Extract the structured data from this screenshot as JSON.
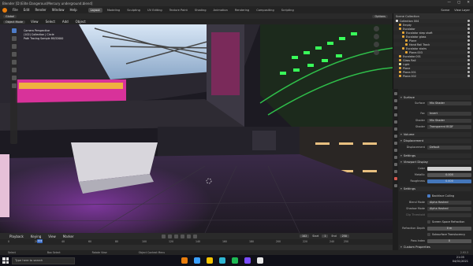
{
  "window": {
    "title": "Blender [D:\\Elite Dangerous\\Mercury underground.blend]",
    "controls": [
      "—",
      "▢",
      "✕"
    ]
  },
  "menubar": {
    "menus": [
      "File",
      "Edit",
      "Render",
      "Window",
      "Help"
    ],
    "workspaces": [
      "Layout",
      "Modeling",
      "Sculpting",
      "UV Editing",
      "Texture Paint",
      "Shading",
      "Animation",
      "Rendering",
      "Compositing",
      "Scripting"
    ],
    "active_workspace": "Layout",
    "scene": "Scene",
    "view_layer": "View Layer"
  },
  "toolbar": {
    "transform": "Global",
    "options": "Options"
  },
  "viewport_header": {
    "mode": "Object Mode",
    "menus": [
      "View",
      "Select",
      "Add",
      "Object"
    ]
  },
  "viewport": {
    "overlay_text": [
      "Camera Perspective",
      "(102) Collection | Circle",
      "Path Tracing Sample 89/32000"
    ]
  },
  "timeline": {
    "menus": [
      "Playback",
      "Keying",
      "View",
      "Marker"
    ],
    "current_frame": "102",
    "start_label": "Start",
    "start_value": "1",
    "end_label": "End",
    "end_value": "250",
    "ticks": [
      "0",
      "20",
      "40",
      "60",
      "80",
      "100",
      "120",
      "140",
      "160",
      "180",
      "200",
      "220",
      "240",
      "250"
    ]
  },
  "statusbar": {
    "items": [
      "Select",
      "Box Select",
      "Rotate View",
      "Object Context Menu"
    ],
    "version": "2.93.3"
  },
  "taskbar": {
    "search_placeholder": "Type here to search",
    "time": "21:05",
    "date": "04/01/2021",
    "icon_colors": [
      "#e87d0d",
      "#3aa0ff",
      "#f5c400",
      "#2fb7d4",
      "#1db954",
      "#7a4cff",
      "#e8e8e8"
    ]
  },
  "outliner": {
    "header": "Scene Collection",
    "rows": [
      {
        "label": "Collection 004",
        "indent": 0,
        "color": "#e0e0e0"
      },
      {
        "label": "Empty",
        "indent": 1,
        "color": "#e8a838"
      },
      {
        "label": "Escalator",
        "indent": 1,
        "color": "#e8a838"
      },
      {
        "label": "Escalator step shaft",
        "indent": 2,
        "color": "#e8a838"
      },
      {
        "label": "Escalator glass",
        "indent": 2,
        "color": "#e8a838"
      },
      {
        "label": "Plane",
        "indent": 3,
        "color": "#e8a838"
      },
      {
        "label": "Hand Rail Track",
        "indent": 3,
        "color": "#e8a838"
      },
      {
        "label": "Escalator stairs",
        "indent": 2,
        "color": "#e8a838"
      },
      {
        "label": "Plane.003",
        "indent": 3,
        "color": "#e8a838"
      },
      {
        "label": "Escalator.001",
        "indent": 1,
        "color": "#e8a838"
      },
      {
        "label": "Glass Rail",
        "indent": 1,
        "color": "#e8a838"
      },
      {
        "label": "Light",
        "indent": 1,
        "color": "#e8e8a8"
      },
      {
        "label": "Plane",
        "indent": 1,
        "color": "#e8a838"
      },
      {
        "label": "Plane.001",
        "indent": 1,
        "color": "#e8a838"
      },
      {
        "label": "Plane.002",
        "indent": 1,
        "color": "#e8a838"
      }
    ]
  },
  "properties": {
    "surface": {
      "title": "Surface",
      "surface_label": "Surface",
      "surface_value": "Mix Shader",
      "fac_label": "Fac",
      "fac_value": "Invert",
      "shader1_label": "Shader",
      "shader1_value": "Mix Shader",
      "shader2_label": "Shader",
      "shader2_value": "Transparent BSDF"
    },
    "volume_title": "Volume",
    "displacement": {
      "title": "Displacement",
      "label": "Displacement",
      "value": "Default"
    },
    "settings_title": "Settings",
    "viewport_display": {
      "title": "Viewport Display",
      "color_label": "Color",
      "metallic_label": "Metallic",
      "metallic_value": "0.000",
      "roughness_label": "Roughness",
      "roughness_value": "0.400"
    },
    "settings2": {
      "title": "Settings",
      "backface_label": "Backface Culling",
      "blend_label": "Blend Mode",
      "blend_value": "Alpha Hashed",
      "shadow_label": "Shadow Mode",
      "shadow_value": "Alpha Hashed",
      "clip_label": "Clip Threshold",
      "ssr_label": "Screen Space Refraction",
      "depth_label": "Refraction Depth",
      "depth_value": "0 m",
      "sss_label": "Subsurface Translucency",
      "pass_label": "Pass Index",
      "pass_value": "0"
    },
    "custom_title": "Custom Properties"
  }
}
